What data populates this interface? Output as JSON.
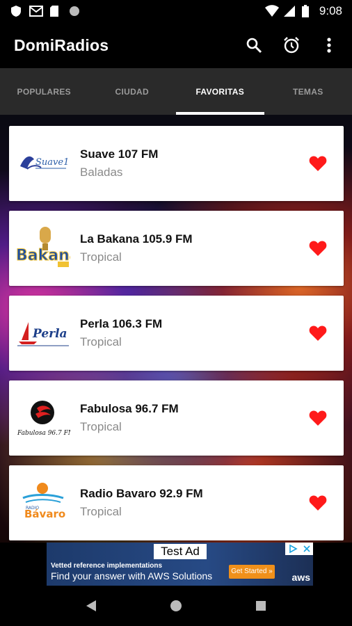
{
  "status_bar": {
    "time": "9:08",
    "icons": [
      "shield-icon",
      "gmail-icon",
      "sd-card-icon",
      "circle-icon",
      "wifi-icon",
      "signal-icon",
      "battery-icon"
    ]
  },
  "app_bar": {
    "title": "DomiRadios",
    "actions": [
      "search-icon",
      "alarm-icon",
      "more-vert-icon"
    ]
  },
  "tabs": [
    {
      "label": "POPULARES",
      "active": false
    },
    {
      "label": "CIUDAD",
      "active": false
    },
    {
      "label": "FAVORITAS",
      "active": true
    },
    {
      "label": "TEMAS",
      "active": false
    }
  ],
  "stations": [
    {
      "name": "Suave 107 FM",
      "genre": "Baladas",
      "logo": "suave-logo",
      "favorite": true
    },
    {
      "name": "La Bakana 105.9 FM",
      "genre": "Tropical",
      "logo": "bakana-logo",
      "favorite": true
    },
    {
      "name": "Perla 106.3 FM",
      "genre": "Tropical",
      "logo": "perla-logo",
      "favorite": true
    },
    {
      "name": "Fabulosa 96.7 FM",
      "genre": "Tropical",
      "logo": "fabulosa-logo",
      "favorite": true
    },
    {
      "name": "Radio Bavaro 92.9 FM",
      "genre": "Tropical",
      "logo": "bavaro-logo",
      "favorite": true
    }
  ],
  "logos": {
    "suave_text": "Suave107",
    "bakana_text": "Bakana",
    "perla_text": "Perla",
    "fabulosa_text": "Fabulosa 96.7 FM",
    "bavaro_text": "Bávaro",
    "bavaro_small": "RADIO"
  },
  "ad": {
    "label": "Test Ad",
    "line1": "Vetted reference implementations",
    "line2": "Find your answer with AWS Solutions",
    "cta": "Get Started »",
    "brand": "aws"
  },
  "colors": {
    "heart": "#ff1a1a",
    "tab_active": "#ffffff",
    "tab_inactive": "#9a9a9a"
  }
}
